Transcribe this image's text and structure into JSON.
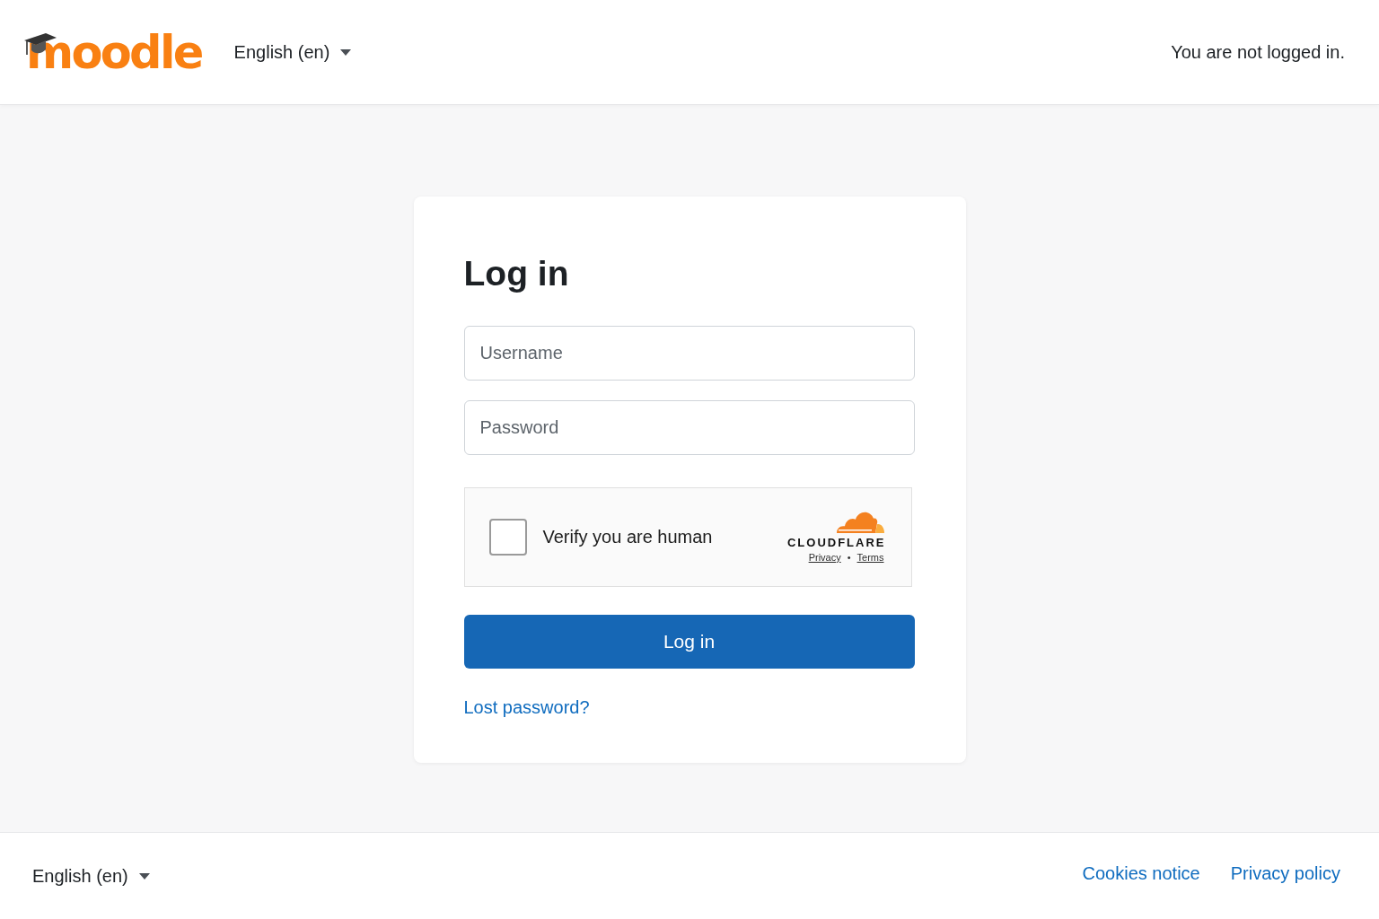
{
  "header": {
    "logo": {
      "text": "moodle"
    },
    "language": {
      "label": "English (en)"
    },
    "login_status": "You are not logged in."
  },
  "login_card": {
    "title": "Log in",
    "username": {
      "placeholder": "Username"
    },
    "password": {
      "placeholder": "Password"
    },
    "captcha": {
      "checked": false,
      "label": "Verify you are human",
      "brand": "CLOUDFLARE",
      "links": [
        "Privacy",
        "Terms"
      ],
      "separator": "•"
    },
    "submit": "Log in",
    "lost_password": "Lost password?"
  },
  "footer": {
    "language": {
      "label": "English (en)"
    },
    "links": [
      "Cookies notice",
      "Privacy policy"
    ]
  }
}
